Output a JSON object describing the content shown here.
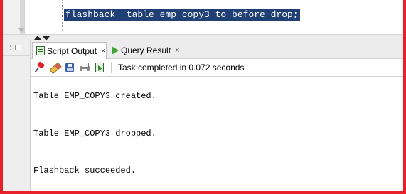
{
  "editor": {
    "sql_line": "flashback  table emp_copy3 to before drop;"
  },
  "tabs": [
    {
      "label": "Script Output",
      "close": "×",
      "active": true
    },
    {
      "label": "Query Result",
      "close": "×",
      "active": false
    }
  ],
  "toolbar": {
    "buttons": [
      "pin-icon",
      "eraser-icon",
      "save-icon",
      "print-icon",
      "run-script-icon"
    ],
    "status": "Task completed in 0.072 seconds"
  },
  "output": {
    "lines": [
      "Table EMP_COPY3 created.",
      "Table EMP_COPY3 dropped.",
      "Flashback succeeded."
    ]
  },
  "colors": {
    "frame_border": "#e8202a",
    "selection_bg": "#1f3f75",
    "selection_text": "#ffffff"
  }
}
